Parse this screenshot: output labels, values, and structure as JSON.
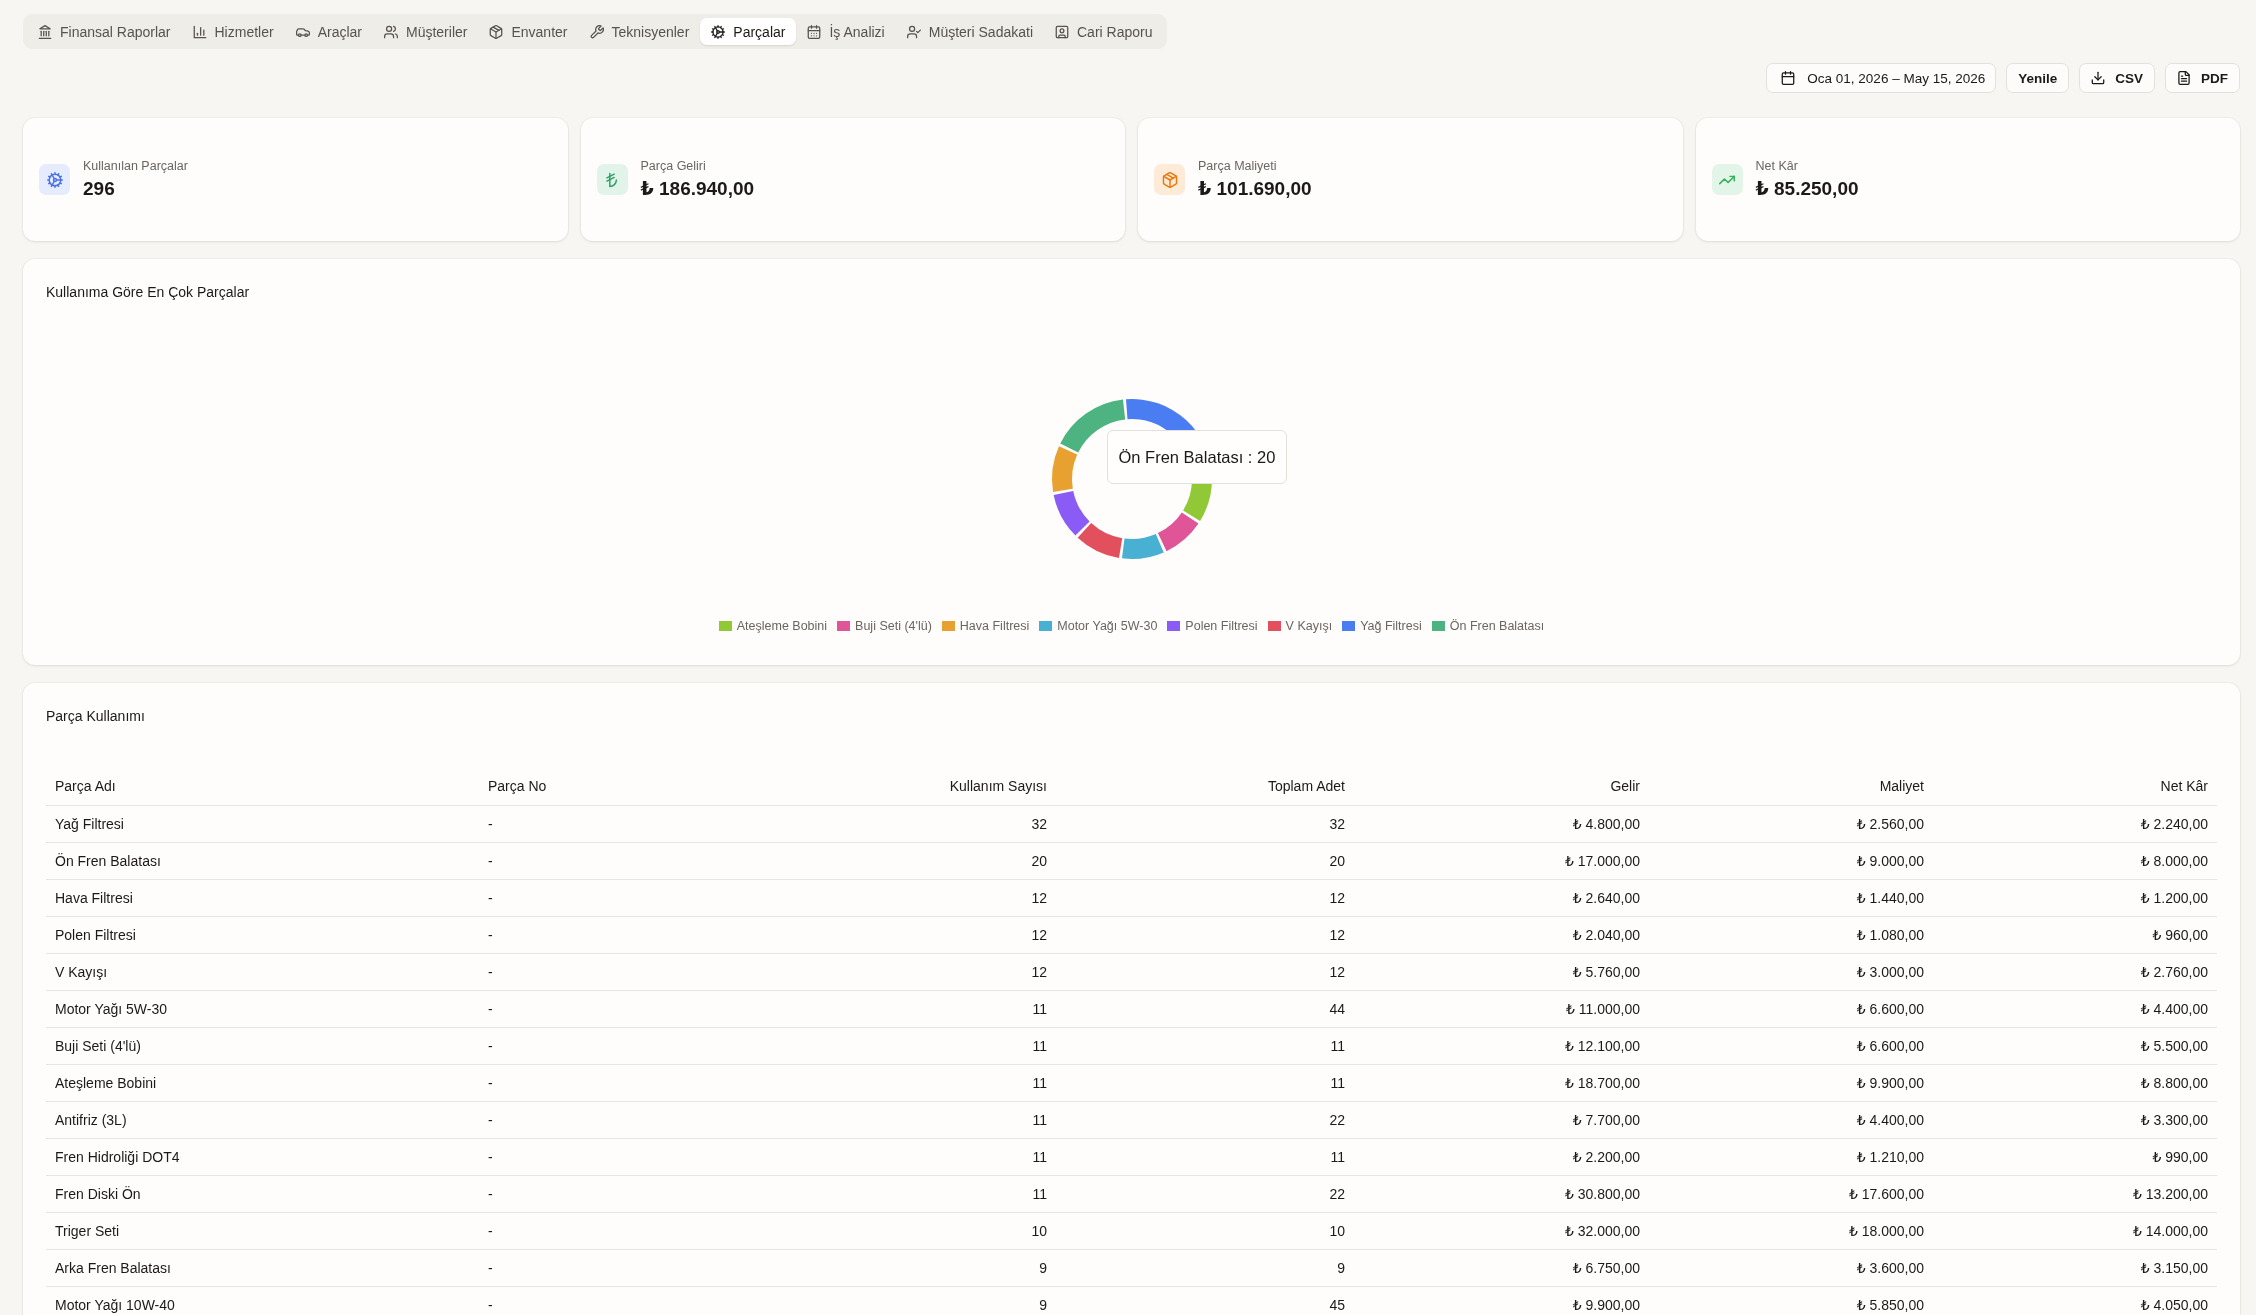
{
  "tabs": [
    {
      "label": "Finansal Raporlar",
      "selected": false
    },
    {
      "label": "Hizmetler",
      "selected": false
    },
    {
      "label": "Araçlar",
      "selected": false
    },
    {
      "label": "Müşteriler",
      "selected": false
    },
    {
      "label": "Envanter",
      "selected": false
    },
    {
      "label": "Teknisyenler",
      "selected": false
    },
    {
      "label": "Parçalar",
      "selected": true
    },
    {
      "label": "İş Analizi",
      "selected": false
    },
    {
      "label": "Müşteri Sadakati",
      "selected": false
    },
    {
      "label": "Cari Raporu",
      "selected": false
    }
  ],
  "toolbar": [
    "Oca 01, 2026 – May 15, 2026",
    "Yenile",
    "CSV",
    "PDF"
  ],
  "stats": [
    {
      "label": "Kullanılan Parçalar",
      "value": "296"
    },
    {
      "label": "Parça Geliri",
      "value": "₺ 186.940,00"
    },
    {
      "label": "Parça Maliyeti",
      "value": "₺ 101.690,00"
    },
    {
      "label": "Net Kâr",
      "value": "₺ 85.250,00"
    }
  ],
  "chart": {
    "chart_data": {
      "type": "donut",
      "title": "Kullanıma Göre En Çok Parçalar",
      "categories": [
        "Yağ Filtresi",
        "Ön Fren Balatası",
        "Hava Filtresi",
        "Polen Filtresi",
        "V Kayışı",
        "Motor Yağı 5W-30",
        "Buji Seti (4'lü)",
        "Ateşleme Bobini"
      ],
      "values": [
        26.5,
        16.5,
        9.9,
        9.9,
        9.9,
        9.1,
        9.1,
        9.1
      ],
      "colors": [
        "#4a7cf2",
        "#4db380",
        "#e8a130",
        "#8a5cf5",
        "#e2505e",
        "#48b0d3",
        "#df5597",
        "#90c935"
      ]
    },
    "tooltip": "Ön Fren Balatası : 20"
  },
  "table": {
    "title": "Parça Kullanımı",
    "columns": [
      "Parça Adı",
      "Parça No",
      "Kullanım Sayısı",
      "Toplam Adet",
      "Gelir",
      "Maliyet",
      "Net Kâr"
    ],
    "rows": [
      [
        "Yağ Filtresi",
        "-",
        "32",
        "32",
        "₺ 4.800,00",
        "₺ 2.560,00",
        "₺ 2.240,00"
      ],
      [
        "Ön Fren Balatası",
        "-",
        "20",
        "20",
        "₺ 17.000,00",
        "₺ 9.000,00",
        "₺ 8.000,00"
      ],
      [
        "Hava Filtresi",
        "-",
        "12",
        "12",
        "₺ 2.640,00",
        "₺ 1.440,00",
        "₺ 1.200,00"
      ],
      [
        "Polen Filtresi",
        "-",
        "12",
        "12",
        "₺ 2.040,00",
        "₺ 1.080,00",
        "₺ 960,00"
      ],
      [
        "V Kayışı",
        "-",
        "12",
        "12",
        "₺ 5.760,00",
        "₺ 3.000,00",
        "₺ 2.760,00"
      ],
      [
        "Motor Yağı 5W-30",
        "-",
        "11",
        "44",
        "₺ 11.000,00",
        "₺ 6.600,00",
        "₺ 4.400,00"
      ],
      [
        "Buji Seti (4'lü)",
        "-",
        "11",
        "11",
        "₺ 12.100,00",
        "₺ 6.600,00",
        "₺ 5.500,00"
      ],
      [
        "Ateşleme Bobini",
        "-",
        "11",
        "11",
        "₺ 18.700,00",
        "₺ 9.900,00",
        "₺ 8.800,00"
      ],
      [
        "Antifriz (3L)",
        "-",
        "11",
        "22",
        "₺ 7.700,00",
        "₺ 4.400,00",
        "₺ 3.300,00"
      ],
      [
        "Fren Hidroliği DOT4",
        "-",
        "11",
        "11",
        "₺ 2.200,00",
        "₺ 1.210,00",
        "₺ 990,00"
      ],
      [
        "Fren Diski Ön",
        "-",
        "11",
        "22",
        "₺ 30.800,00",
        "₺ 17.600,00",
        "₺ 13.200,00"
      ],
      [
        "Triger Seti",
        "-",
        "10",
        "10",
        "₺ 32.000,00",
        "₺ 18.000,00",
        "₺ 14.000,00"
      ],
      [
        "Arka Fren Balatası",
        "-",
        "9",
        "9",
        "₺ 6.750,00",
        "₺ 3.600,00",
        "₺ 3.150,00"
      ],
      [
        "Motor Yağı 10W-40",
        "-",
        "9",
        "45",
        "₺ 9.900,00",
        "₺ 5.850,00",
        "₺ 4.050,00"
      ]
    ]
  }
}
